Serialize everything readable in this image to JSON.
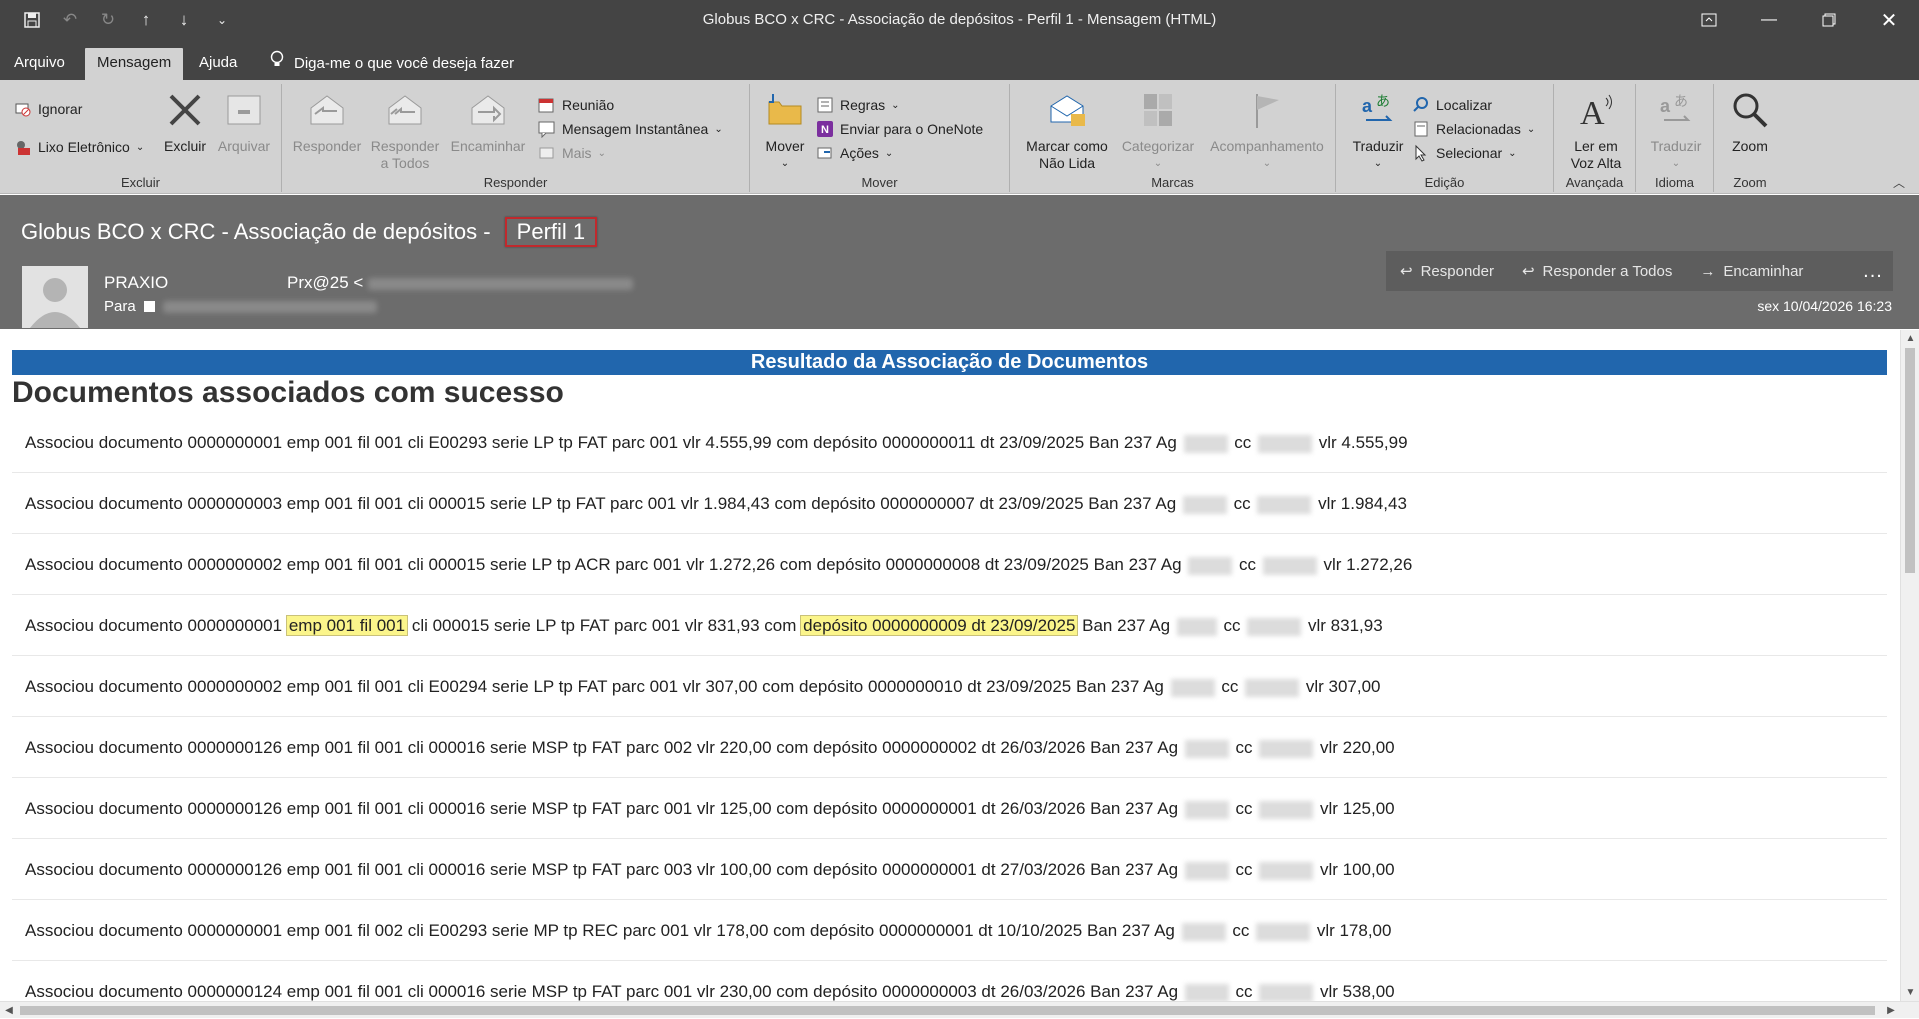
{
  "window": {
    "title": "Globus BCO x CRC - Associação de depósitos - Perfil 1  -  Mensagem (HTML)"
  },
  "qat": {
    "icons": [
      "save-icon",
      "undo-icon",
      "redo-icon",
      "up-arrow-icon",
      "down-arrow-icon",
      "customize-icon"
    ]
  },
  "menu": {
    "tabs": [
      "Arquivo",
      "Mensagem",
      "Ajuda"
    ],
    "active_tab": "Mensagem",
    "tell_me": "Diga-me o que você deseja fazer"
  },
  "ribbon": {
    "excluir": {
      "label": "Excluir",
      "ignorar": "Ignorar",
      "lixo": "Lixo Eletrônico",
      "excluir_btn": "Excluir",
      "arquivar_btn": "Arquivar"
    },
    "responder": {
      "label": "Responder",
      "responder_l1": "Responder",
      "todos_l1": "Responder",
      "todos_l2": "a Todos",
      "encaminhar": "Encaminhar",
      "reuniao": "Reunião",
      "mensagem_inst": "Mensagem Instantânea",
      "mais": "Mais"
    },
    "mover": {
      "label": "Mover",
      "mover_btn": "Mover",
      "regras": "Regras",
      "onenote": "Enviar para o OneNote",
      "acoes": "Ações"
    },
    "marcas": {
      "label": "Marcas",
      "marcar_l1": "Marcar como",
      "marcar_l2": "Não Lida",
      "categorizar": "Categorizar",
      "acompanhamento": "Acompanhamento"
    },
    "edicao": {
      "label": "Edição",
      "traduzir": "Traduzir",
      "localizar": "Localizar",
      "relacionadas": "Relacionadas",
      "selecionar": "Selecionar"
    },
    "avancada": {
      "label": "Avançada",
      "ler_l1": "Ler em",
      "ler_l2": "Voz Alta"
    },
    "idioma": {
      "label": "Idioma",
      "traduzir": "Traduzir"
    },
    "zoom": {
      "label": "Zoom",
      "zoom_btn": "Zoom"
    }
  },
  "message": {
    "subject": "Globus BCO x CRC - Associação de depósitos - ",
    "subject_highlight": "Perfil 1",
    "sender_name": "PRAXIO",
    "sender_email_prefix": "Prx@25 <",
    "to_label": "Para",
    "datetime": "sex 10/04/2026 16:23",
    "actions": {
      "reply": "Responder",
      "reply_all": "Responder a Todos",
      "forward": "Encaminhar",
      "more": "..."
    }
  },
  "body": {
    "banner": "Resultado da Associação de Documentos",
    "heading": "Documentos associados com sucesso",
    "rows": [
      {
        "a": "Associou documento 0000000001 emp 001 fil 001 cli E00293 serie LP tp FAT parc 001 vlr 4.555,99 com depósito 0000000011 dt 23/09/2025 Ban 237 Ag",
        "b": "cc",
        "c": "vlr 4.555,99"
      },
      {
        "a": "Associou documento 0000000003 emp 001 fil 001 cli 000015 serie LP tp FAT parc 001 vlr 1.984,43 com depósito 0000000007 dt 23/09/2025 Ban 237 Ag",
        "b": "cc",
        "c": "vlr 1.984,43"
      },
      {
        "a": "Associou documento 0000000002 emp 001 fil 001 cli 000015 serie LP tp ACR parc 001 vlr 1.272,26 com depósito 0000000008 dt 23/09/2025 Ban 237 Ag",
        "b": "cc",
        "c": "vlr 1.272,26"
      },
      {
        "a": "Associou documento 0000000001",
        "hl1": "emp 001 fil 001",
        "a2": "cli 000015 serie LP tp FAT parc 001 vlr 831,93 com",
        "hl2": "depósito 0000000009 dt 23/09/2025",
        "a3": "Ban 237 Ag",
        "b": "cc",
        "c": "vlr 831,93"
      },
      {
        "a": "Associou documento 0000000002 emp 001 fil 001 cli E00294 serie LP tp FAT parc 001 vlr 307,00 com depósito 0000000010 dt 23/09/2025 Ban 237 Ag",
        "b": "cc",
        "c": "vlr 307,00"
      },
      {
        "a": "Associou documento 0000000126 emp 001 fil 001 cli 000016 serie MSP tp FAT parc 002 vlr 220,00 com depósito 0000000002 dt 26/03/2026 Ban 237 Ag",
        "b": "cc",
        "c": "vlr 220,00"
      },
      {
        "a": "Associou documento 0000000126 emp 001 fil 001 cli 000016 serie MSP tp FAT parc 001 vlr 125,00 com depósito 0000000001 dt 26/03/2026 Ban 237 Ag",
        "b": "cc",
        "c": "vlr 125,00"
      },
      {
        "a": "Associou documento 0000000126 emp 001 fil 001 cli 000016 serie MSP tp FAT parc 003 vlr 100,00 com depósito 0000000001 dt 27/03/2026 Ban 237 Ag",
        "b": "cc",
        "c": "vlr 100,00"
      },
      {
        "a": "Associou documento 0000000001 emp 001 fil 002 cli E00293 serie MP tp REC parc 001 vlr 178,00 com depósito 0000000001 dt 10/10/2025 Ban 237 Ag",
        "b": "cc",
        "c": "vlr 178,00"
      },
      {
        "a": "Associou documento 0000000124 emp 001 fil 001 cli 000016 serie MSP tp FAT parc 001 vlr 230,00 com depósito 0000000003 dt 26/03/2026 Ban 237 Ag",
        "b": "cc",
        "c": "vlr 538,00"
      }
    ]
  }
}
